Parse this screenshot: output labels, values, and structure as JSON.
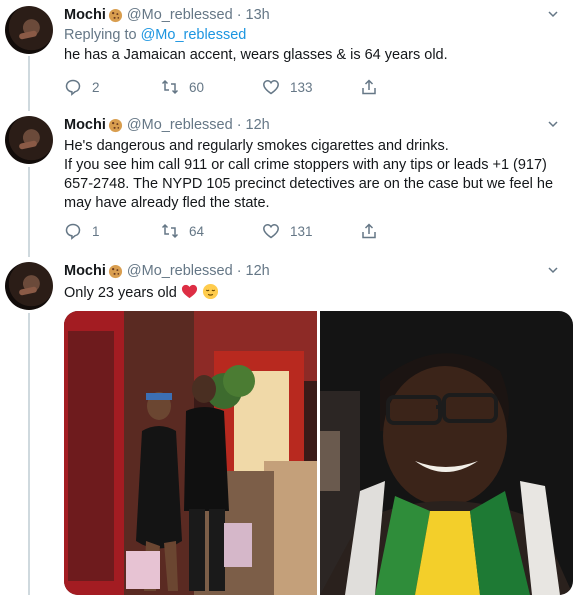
{
  "tweets": [
    {
      "name": "Mochi",
      "handle": "@Mo_reblessed",
      "time": "13h",
      "reply_prefix": "Replying to",
      "reply_handle": "@Mo_reblessed",
      "text": "he has a Jamaican accent, wears glasses & is 64 years old.",
      "replies": "2",
      "retweets": "60",
      "likes": "133"
    },
    {
      "name": "Mochi",
      "handle": "@Mo_reblessed",
      "time": "12h",
      "text_lines": [
        "He's dangerous and regularly smokes cigarettes and drinks.",
        "If you see him call 911 or call crime stoppers with any tips or leads +1 (917)",
        "657-2748. The NYPD 105 precinct detectives are on the case but we feel he",
        "may have already fled the state."
      ],
      "replies": "1",
      "retweets": "64",
      "likes": "131"
    },
    {
      "name": "Mochi",
      "handle": "@Mo_reblessed",
      "time": "12h",
      "text": "Only 23 years old"
    }
  ],
  "icons": [
    "cookie-emoji",
    "chevron-down-icon",
    "reply-icon",
    "retweet-icon",
    "like-icon",
    "share-icon",
    "red-heart-emoji",
    "relieved-face-emoji"
  ],
  "colors": {
    "link": "#1b95e0",
    "secondary": "#657786",
    "heart": "#e0245e"
  }
}
